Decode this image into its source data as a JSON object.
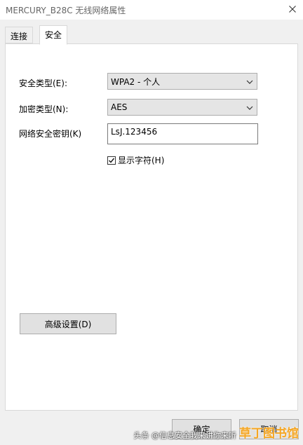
{
  "window": {
    "title": "MERCURY_B28C 无线网络属性",
    "close_icon": "close-icon"
  },
  "tabs": [
    {
      "label": "连接",
      "active": false
    },
    {
      "label": "安全",
      "active": true
    }
  ],
  "security": {
    "security_type_label": "安全类型(E):",
    "security_type_value": "WPA2 - 个人",
    "encryption_type_label": "加密类型(N):",
    "encryption_type_value": "AES",
    "network_key_label": "网络安全密钥(K)",
    "network_key_value": "LsJ.123456",
    "show_chars_label": "显示字符(H)",
    "show_chars_checked": true
  },
  "buttons": {
    "advanced": "高级设置(D)",
    "ok": "确定",
    "cancel": "取消"
  },
  "watermark": {
    "brand": "草丁图书馆",
    "subtitle": "头条 @信息安全我来讲你来听"
  },
  "colors": {
    "window_bg": "#f0f0f0",
    "panel_bg": "#ffffff",
    "button_bg": "#e1e1e1",
    "watermark_brand": "#f5a623"
  }
}
